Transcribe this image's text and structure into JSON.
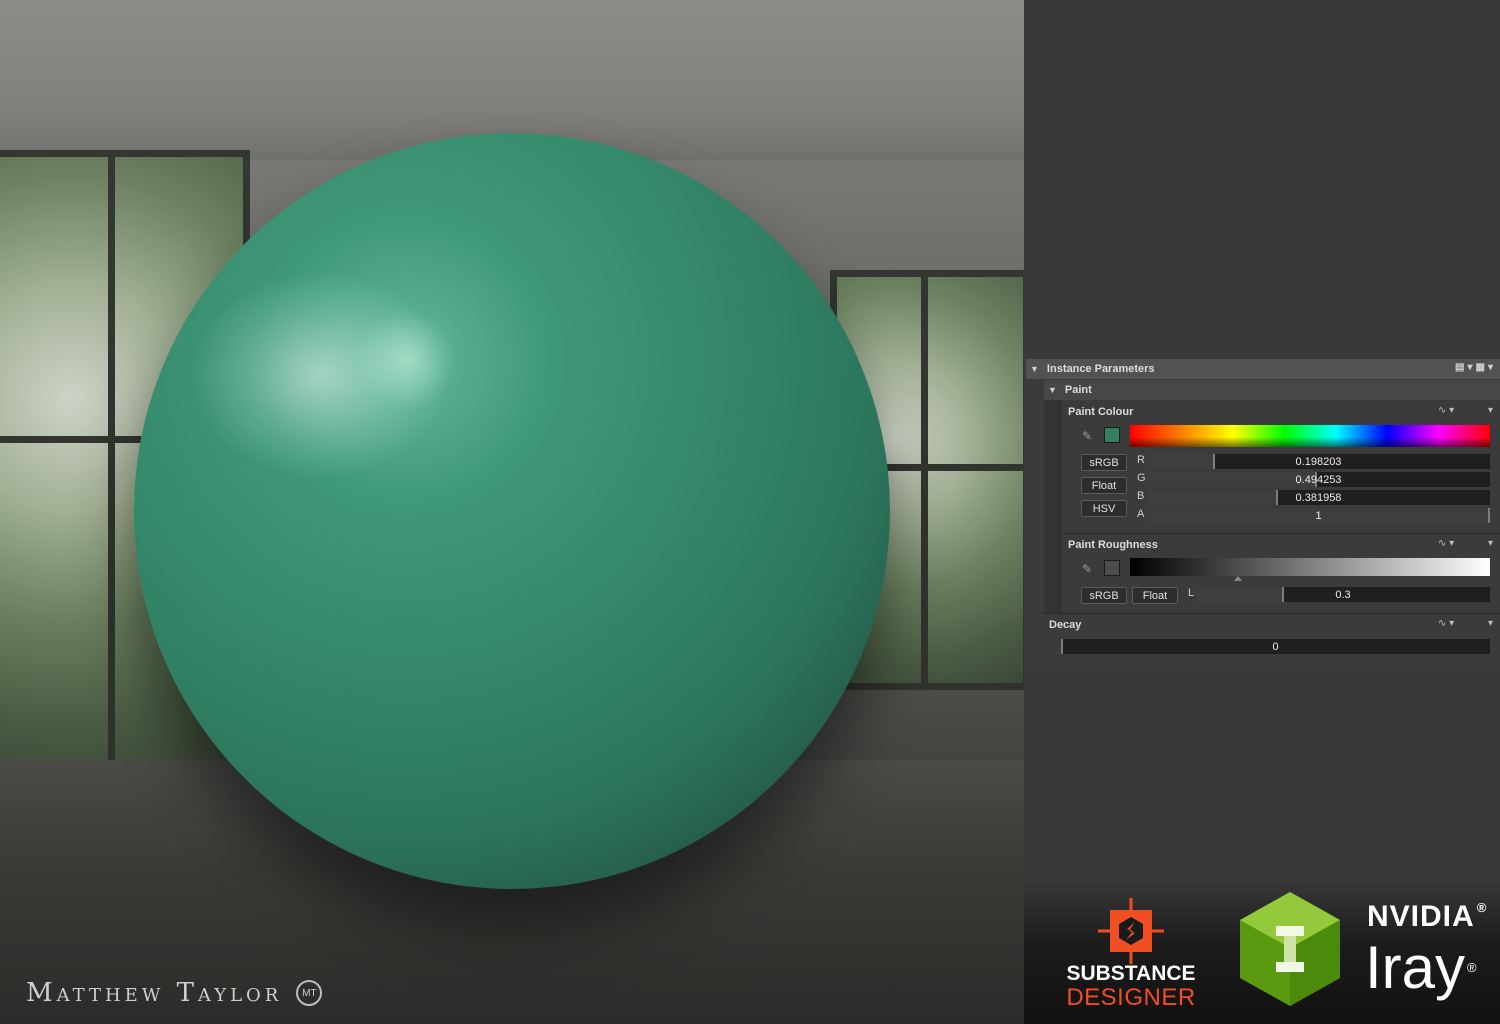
{
  "instance_parameters": {
    "title": "Instance Parameters",
    "tool_icons": [
      "document-icon",
      "chevron-down-icon",
      "file-stack-icon",
      "chevron-down-icon"
    ]
  },
  "paint_group": {
    "title": "Paint",
    "paint_colour": {
      "label": "Paint Colour",
      "swatch_color": "#327e61",
      "buttons": [
        "sRGB",
        "Float",
        "HSV"
      ],
      "channels": [
        {
          "name": "R",
          "value": "0.198203",
          "fraction": 0.198203
        },
        {
          "name": "G",
          "value": "0.494253",
          "fraction": 0.494253
        },
        {
          "name": "B",
          "value": "0.381958",
          "fraction": 0.381958
        },
        {
          "name": "A",
          "value": "1",
          "fraction": 1
        }
      ]
    },
    "paint_roughness": {
      "label": "Paint Roughness",
      "swatch_color": "#4d4d4d",
      "buttons": [
        "sRGB",
        "Float"
      ],
      "channel": "L",
      "value": "0.3",
      "fraction": 0.3
    }
  },
  "decay": {
    "label": "Decay",
    "value": "0",
    "fraction": 0
  },
  "signature": {
    "name": "Matthew Taylor",
    "monogram": "MT"
  },
  "logos": {
    "substance_line1": "SUBSTANCE",
    "substance_line2": "DESIGNER",
    "nvidia": "NVIDIA",
    "iray": "Iray",
    "registered": "®"
  },
  "colors": {
    "sphere": "#3a8f70",
    "panel_bg": "#3b3b3b",
    "substance_orange": "#f04e23",
    "iray_green": "#76b900"
  }
}
